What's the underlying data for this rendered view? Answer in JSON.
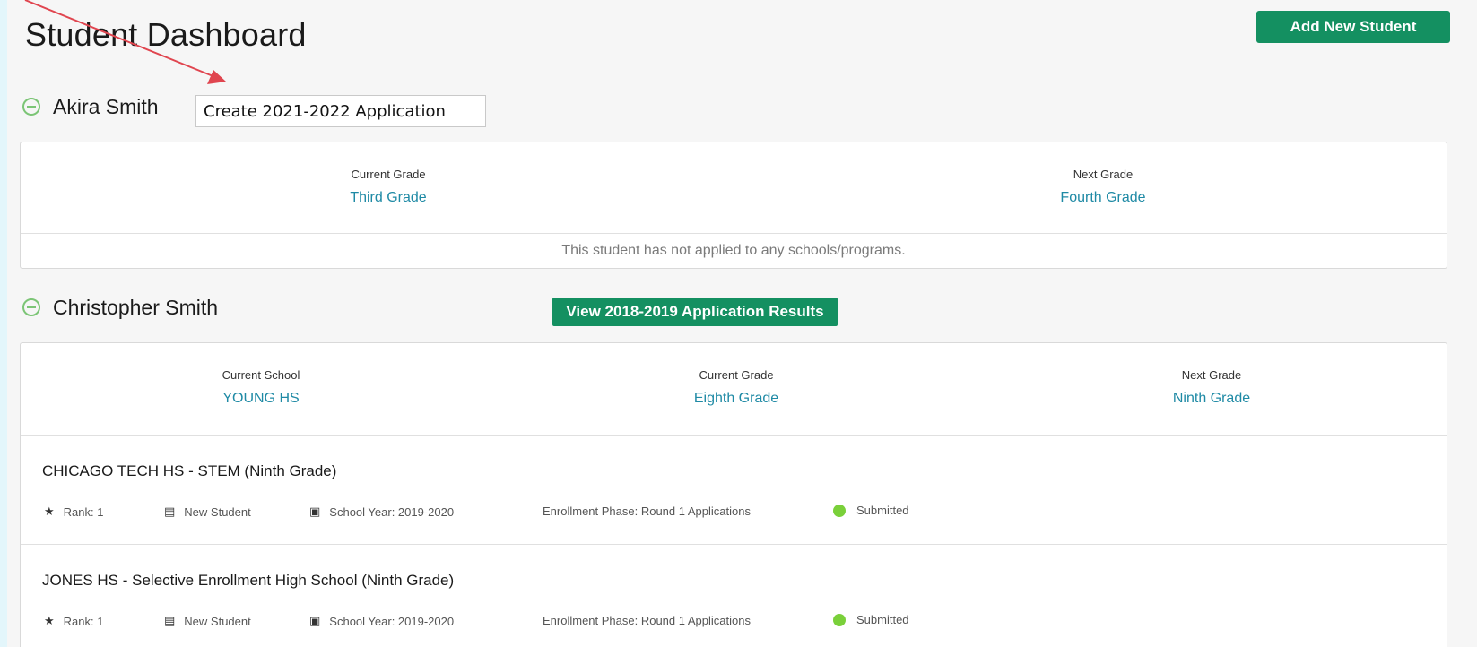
{
  "page_title": "Student Dashboard",
  "add_student_label": "Add New Student",
  "students": [
    {
      "name": "Akira Smith",
      "action_label": "Create 2021-2022 Application",
      "grades": [
        {
          "label": "Current Grade",
          "value": "Third Grade"
        },
        {
          "label": "Next Grade",
          "value": "Fourth Grade"
        }
      ],
      "no_applications_text": "This student has not applied to any schools/programs."
    },
    {
      "name": "Christopher Smith",
      "action_label": "View 2018-2019 Application Results",
      "grades": [
        {
          "label": "Current School",
          "value": "YOUNG HS"
        },
        {
          "label": "Current Grade",
          "value": "Eighth Grade"
        },
        {
          "label": "Next Grade",
          "value": "Ninth Grade"
        }
      ],
      "applications": [
        {
          "title": "CHICAGO TECH HS - STEM (Ninth Grade)",
          "rank": "Rank: 1",
          "student_type": "New Student",
          "school_year": "School Year: 2019-2020",
          "phase": "Enrollment Phase: Round 1 Applications",
          "status": "Submitted"
        },
        {
          "title": "JONES HS - Selective Enrollment High School (Ninth Grade)",
          "rank": "Rank: 1",
          "student_type": "New Student",
          "school_year": "School Year: 2019-2020",
          "phase": "Enrollment Phase: Round 1 Applications",
          "status": "Submitted"
        }
      ]
    }
  ],
  "colors": {
    "brand_green": "#149061",
    "link_teal": "#1f8aa5",
    "status_green": "#7ad03a",
    "annotation_arrow": "#e0454f"
  },
  "icons": {
    "collapse": "minus-circle-icon",
    "rank": "star-icon",
    "student_type": "document-icon",
    "school_year": "calendar-icon",
    "status": "status-dot-icon"
  }
}
